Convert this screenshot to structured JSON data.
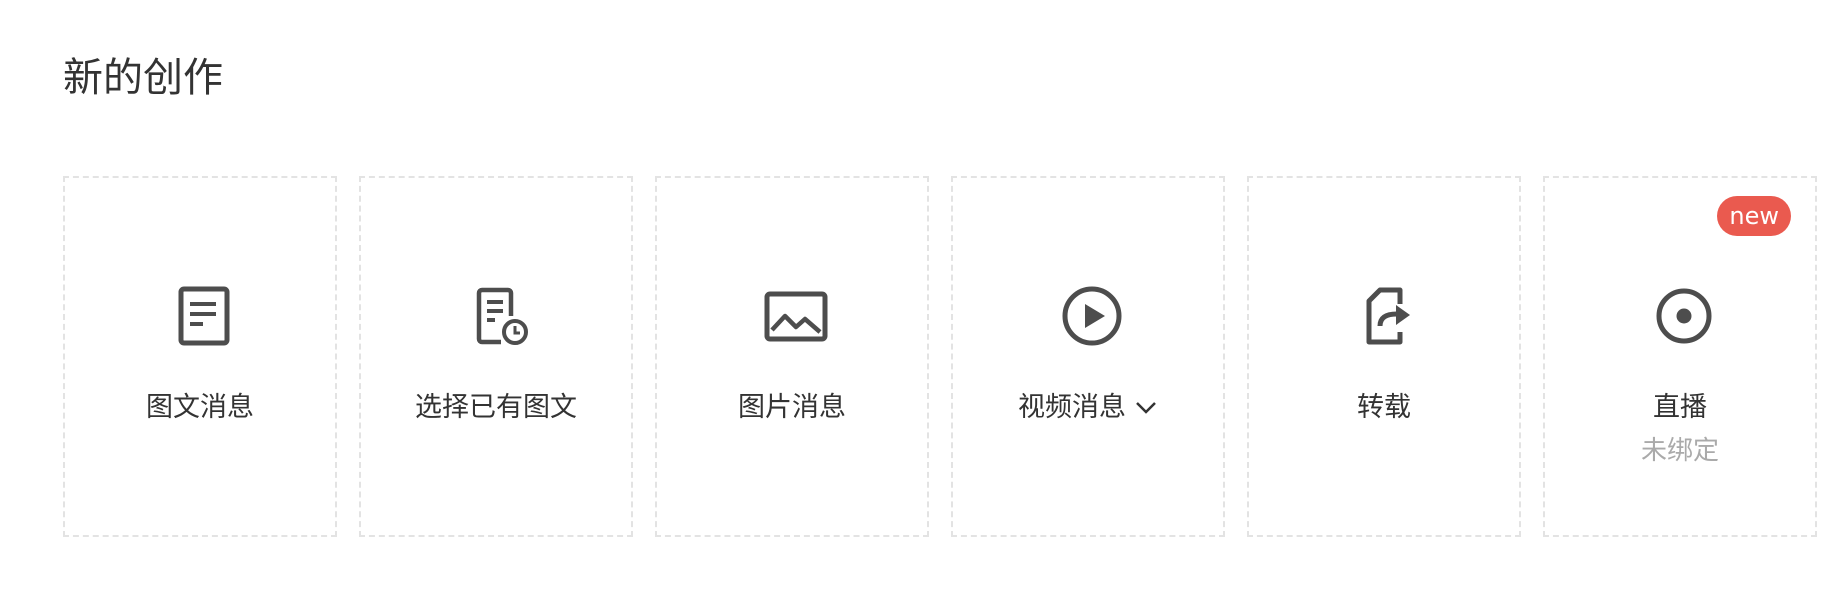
{
  "section": {
    "title": "新的创作"
  },
  "cards": [
    {
      "label": "图文消息",
      "icon": "document-icon"
    },
    {
      "label": "选择已有图文",
      "icon": "document-clock-icon"
    },
    {
      "label": "图片消息",
      "icon": "image-icon"
    },
    {
      "label": "视频消息",
      "icon": "play-circle-icon",
      "dropdown_icon": "chevron-down-icon"
    },
    {
      "label": "转载",
      "icon": "share-file-icon"
    },
    {
      "label": "直播",
      "icon": "radio-button-icon",
      "sublabel": "未绑定",
      "badge": "new"
    }
  ],
  "colors": {
    "icon": "#4d4d4d",
    "text": "#333333",
    "subtext": "#aaaaaa",
    "badge_bg": "#ea5a4f",
    "card_border": "#e3e3e3"
  }
}
